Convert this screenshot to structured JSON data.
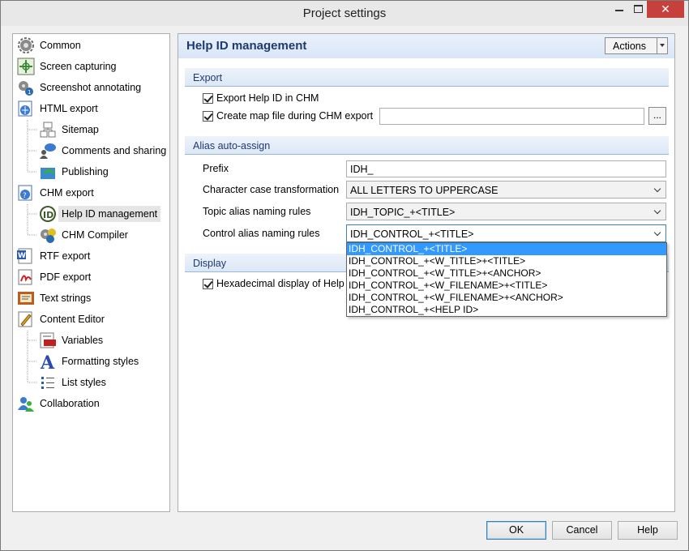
{
  "window": {
    "title": "Project settings",
    "close_glyph": "✕"
  },
  "tree": {
    "items": [
      {
        "label": "Common",
        "icon": "gears-icon"
      },
      {
        "label": "Screen capturing",
        "icon": "crosshair-icon"
      },
      {
        "label": "Screenshot annotating",
        "icon": "annotate-gear-icon"
      },
      {
        "label": "HTML export",
        "icon": "html-export-icon"
      },
      {
        "label": "Sitemap",
        "icon": "sitemap-icon"
      },
      {
        "label": "Comments and sharing",
        "icon": "people-comment-icon"
      },
      {
        "label": "Publishing",
        "icon": "publish-icon"
      },
      {
        "label": "CHM export",
        "icon": "chm-export-icon"
      },
      {
        "label": "Help ID management",
        "icon": "id-badge-icon"
      },
      {
        "label": "CHM Compiler",
        "icon": "chm-compiler-icon"
      },
      {
        "label": "RTF export",
        "icon": "rtf-doc-icon"
      },
      {
        "label": "PDF export",
        "icon": "pdf-doc-icon"
      },
      {
        "label": "Text strings",
        "icon": "text-strings-icon"
      },
      {
        "label": "Content Editor",
        "icon": "pen-doc-icon"
      },
      {
        "label": "Variables",
        "icon": "variables-icon"
      },
      {
        "label": "Formatting styles",
        "icon": "letter-a-icon"
      },
      {
        "label": "List styles",
        "icon": "list-icon"
      },
      {
        "label": "Collaboration",
        "icon": "collaboration-icon"
      }
    ]
  },
  "panel": {
    "title": "Help ID management",
    "actions_label": "Actions"
  },
  "export": {
    "section_label": "Export",
    "export_help_id_label": "Export Help ID in CHM",
    "export_help_id_checked": true,
    "create_map_label": "Create map file during CHM export",
    "create_map_checked": true,
    "map_file_value": "",
    "browse_label": "..."
  },
  "alias": {
    "section_label": "Alias auto-assign",
    "prefix_label": "Prefix",
    "prefix_value": "IDH_",
    "case_label": "Character case transformation",
    "case_value": "ALL LETTERS TO UPPERCASE",
    "topic_label": "Topic alias naming rules",
    "topic_value": "IDH_TOPIC_+<TITLE>",
    "control_label": "Control alias naming rules",
    "control_value": "IDH_CONTROL_+<TITLE>",
    "control_options": [
      "IDH_CONTROL_+<TITLE>",
      "IDH_CONTROL_+<W_TITLE>+<TITLE>",
      "IDH_CONTROL_+<W_TITLE>+<ANCHOR>",
      "IDH_CONTROL_+<W_FILENAME>+<TITLE>",
      "IDH_CONTROL_+<W_FILENAME>+<ANCHOR>",
      "IDH_CONTROL_+<HELP ID>"
    ]
  },
  "display": {
    "section_label": "Display",
    "hex_label": "Hexadecimal display of Help ID",
    "hex_checked": true
  },
  "footer": {
    "ok_label": "OK",
    "cancel_label": "Cancel",
    "help_label": "Help"
  },
  "colors": {
    "accent": "#3399ff",
    "section_text": "#1e3a6e",
    "close_red": "#c7413c"
  }
}
